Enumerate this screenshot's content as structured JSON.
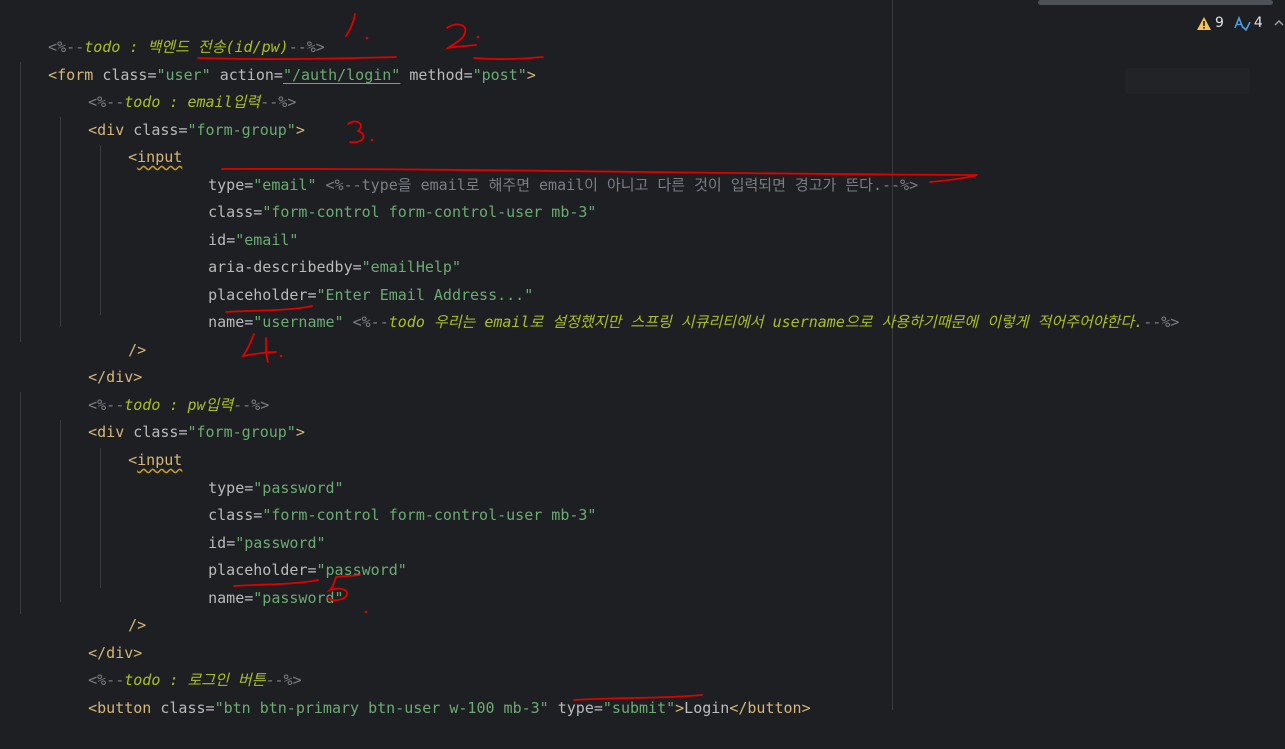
{
  "editor": {
    "inspections": {
      "warning_count": "9",
      "weak_warning_count": "4",
      "warning_color": "#f2c55c",
      "weak_warning_color": "#4f9ee3"
    },
    "colors": {
      "background": "#1e1f22",
      "annotation_ink": "#e00000"
    },
    "lines": {
      "l1": {
        "open": "<%--",
        "todo": "todo : 백엔드 전송(id/pw)",
        "close": "--%>"
      },
      "l2": {
        "tag_open": "<form",
        "attr1": "class",
        "eq1": "=",
        "val1": "\"user\"",
        "attr2": "action",
        "eq2": "=",
        "val2": "\"/auth/login\"",
        "attr3": "method",
        "eq3": "=",
        "val3": "\"post\"",
        "tag_close": ">"
      },
      "l3": {
        "open": "<%--",
        "todo": "todo : email입력",
        "close": "--%>"
      },
      "l4": {
        "tag_open": "<div",
        "attr": "class",
        "eq": "=",
        "val": "\"form-group\"",
        "tag_close": ">"
      },
      "l5": {
        "lt": "<",
        "tag": "input"
      },
      "l6": {
        "attr": "type",
        "eq": "=",
        "val": "\"email\"",
        "comment": "<%--type을 email로 해주면 email이 아니고 다른 것이 입력되면 경고가 뜬다.--%>"
      },
      "l7": {
        "attr": "class",
        "eq": "=",
        "val": "\"form-control form-control-user mb-3\""
      },
      "l8": {
        "attr": "id",
        "eq": "=",
        "val": "\"email\""
      },
      "l9": {
        "attr": "aria-describedby",
        "eq": "=",
        "val": "\"emailHelp\""
      },
      "l10": {
        "attr": "placeholder",
        "eq": "=",
        "val": "\"Enter Email Address...\""
      },
      "l11": {
        "attr": "name",
        "eq": "=",
        "val": "\"username\"",
        "open": "<%--",
        "todo": "todo 우리는 email로 설정했지만 스프링 시큐리티에서 username으로 사용하기때문에 이렇게 적어주어야한다.",
        "close": "--%>"
      },
      "l12": {
        "tag": "/>"
      },
      "l13": {
        "tag": "</div>"
      },
      "l14": {
        "open": "<%--",
        "todo": "todo : pw입력",
        "close": "--%>"
      },
      "l15": {
        "tag_open": "<div",
        "attr": "class",
        "eq": "=",
        "val": "\"form-group\"",
        "tag_close": ">"
      },
      "l16": {
        "lt": "<",
        "tag": "input"
      },
      "l17": {
        "attr": "type",
        "eq": "=",
        "val": "\"password\""
      },
      "l18": {
        "attr": "class",
        "eq": "=",
        "val": "\"form-control form-control-user mb-3\""
      },
      "l19": {
        "attr": "id",
        "eq": "=",
        "val": "\"password\""
      },
      "l20": {
        "attr": "placeholder",
        "eq": "=",
        "val": "\"password\""
      },
      "l21": {
        "attr": "name",
        "eq": "=",
        "val": "\"password\""
      },
      "l22": {
        "tag": "/>"
      },
      "l23": {
        "tag": "</div>"
      },
      "l24": {
        "open": "<%--",
        "todo": "todo : 로그인 버튼",
        "close": "--%>"
      },
      "l25": {
        "tag_open": "<button",
        "attr1": "class",
        "eq1": "=",
        "val1": "\"btn btn-primary btn-user w-100 mb-3\"",
        "attr2": "type",
        "eq2": "=",
        "val2": "\"submit\"",
        "gt": ">",
        "text": "Login",
        "tag_close": "</button>"
      }
    },
    "annotations": [
      {
        "label": "1."
      },
      {
        "label": "2."
      },
      {
        "label": "3."
      },
      {
        "label": "4."
      },
      {
        "label": "5."
      }
    ]
  }
}
